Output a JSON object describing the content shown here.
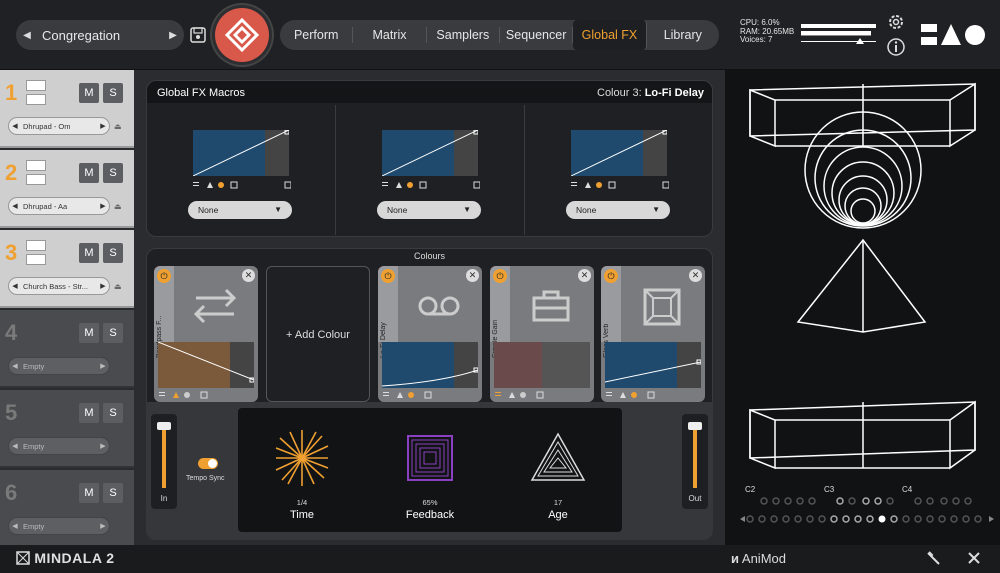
{
  "header": {
    "preset_name": "Congregation",
    "tabs": [
      "Perform",
      "Matrix",
      "Samplers",
      "Sequencer",
      "Global FX",
      "Library"
    ],
    "active_tab": "Global FX",
    "stats": {
      "cpu": "CPU: 6.0%",
      "ram": "RAM: 20.65MB",
      "voices": "Voices: 7"
    }
  },
  "slots": [
    {
      "number": "1",
      "mute": "M",
      "solo": "S",
      "sample": "Dhrupad - Om",
      "loaded": true
    },
    {
      "number": "2",
      "mute": "M",
      "solo": "S",
      "sample": "Dhrupad - Aa",
      "loaded": true
    },
    {
      "number": "3",
      "mute": "M",
      "solo": "S",
      "sample": "Church Bass - Str...",
      "loaded": true
    },
    {
      "number": "4",
      "mute": "M",
      "solo": "S",
      "sample": "Empty",
      "loaded": false
    },
    {
      "number": "5",
      "mute": "M",
      "solo": "S",
      "sample": "Empty",
      "loaded": false
    },
    {
      "number": "6",
      "mute": "M",
      "solo": "S",
      "sample": "Empty",
      "loaded": false
    }
  ],
  "macros": {
    "title": "Global FX Macros",
    "colour_prefix": "Colour 3: ",
    "colour_name": "Lo-Fi Delay",
    "items": [
      {
        "assign": "None"
      },
      {
        "assign": "None"
      },
      {
        "assign": "None"
      }
    ]
  },
  "colours": {
    "label": "Colours",
    "add_label": "+ Add Colour",
    "cards": [
      {
        "name": "Bandpass F...",
        "tint": "#7a5a3a"
      },
      {
        "name": "Lo-Fi Delay",
        "tint": "#1f4a6e"
      },
      {
        "name": "Simple Gain",
        "tint": "#6a4a4a"
      },
      {
        "name": "Glass Verb",
        "tint": "#1f4a6e"
      }
    ]
  },
  "fx": {
    "in_label": "In",
    "out_label": "Out",
    "tempo_sync_label": "Tempo Sync",
    "params": [
      {
        "name": "Time",
        "value": "1/4"
      },
      {
        "name": "Feedback",
        "value": "65%"
      },
      {
        "name": "Age",
        "value": "17"
      }
    ]
  },
  "keyboard": {
    "labels": [
      "C2",
      "C3",
      "C4"
    ]
  },
  "footer": {
    "brand": "MINDALA 2",
    "animod": "AniMod"
  },
  "colors": {
    "accent": "#f0a030",
    "logo": "#d8584a",
    "graph": "#1f4a6e"
  }
}
